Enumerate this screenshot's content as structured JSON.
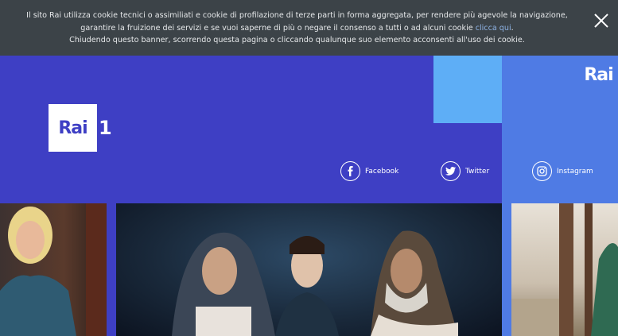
{
  "cookie_banner": {
    "line1": "Il sito Rai utilizza cookie tecnici o assimiliati e cookie di profilazione di terze parti in forma aggregata, per rendere più agevole la navigazione,",
    "line2_prefix": "garantire la fruizione dei servizi e se vuoi saperne di più o negare il consenso a tutti o ad alcuni cookie ",
    "line2_link": "clicca qui",
    "line2_suffix": ".",
    "line3": "Chiudendo questo banner, scorrendo questa pagina o cliccando qualunque suo elemento acconsenti all'uso dei cookie.",
    "close_icon": "close-icon"
  },
  "header": {
    "logo_text": "Rai",
    "logo_channel": "1",
    "corner_logo": "Rai"
  },
  "social": {
    "facebook": "Facebook",
    "twitter": "Twitter",
    "instagram": "Instagram"
  },
  "colors": {
    "background": "#3e3fc4",
    "banner": "#3c4348",
    "light_square": "#5eaef6",
    "side_panel": "#4f7be4",
    "link": "#8fb4e6"
  }
}
